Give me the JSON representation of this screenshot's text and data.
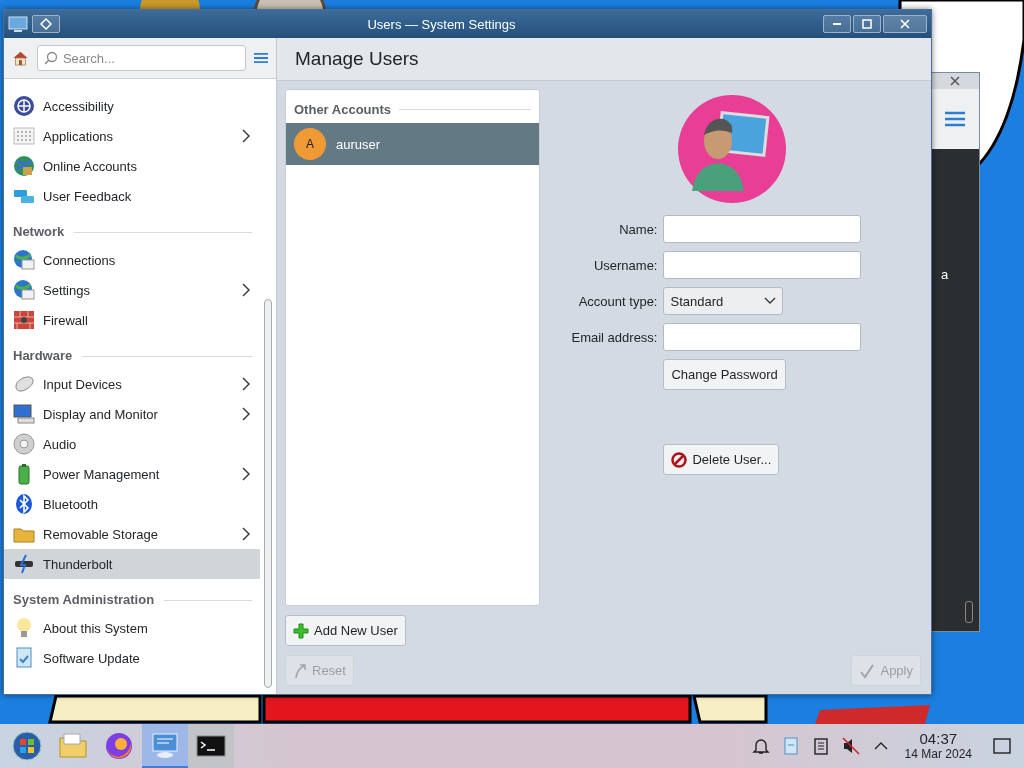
{
  "window": {
    "title": "Users — System Settings"
  },
  "sidebar": {
    "search": {
      "placeholder": "Search..."
    },
    "sections": [
      {
        "items": [
          {
            "label": "Accessibility",
            "kind": "accessibility",
            "has_children": false,
            "selected": false
          },
          {
            "label": "Applications",
            "kind": "applications",
            "has_children": true,
            "selected": false
          },
          {
            "label": "Online Accounts",
            "kind": "accounts",
            "has_children": false,
            "selected": false
          },
          {
            "label": "User Feedback",
            "kind": "feedback",
            "has_children": false,
            "selected": false
          }
        ]
      },
      {
        "title": "Network",
        "items": [
          {
            "label": "Connections",
            "kind": "globe",
            "has_children": false,
            "selected": false
          },
          {
            "label": "Settings",
            "kind": "globe",
            "has_children": true,
            "selected": false
          },
          {
            "label": "Firewall",
            "kind": "firewall",
            "has_children": false,
            "selected": false
          }
        ]
      },
      {
        "title": "Hardware",
        "items": [
          {
            "label": "Input Devices",
            "kind": "mouse",
            "has_children": true,
            "selected": false
          },
          {
            "label": "Display and Monitor",
            "kind": "monitor",
            "has_children": true,
            "selected": false
          },
          {
            "label": "Audio",
            "kind": "audio",
            "has_children": false,
            "selected": false
          },
          {
            "label": "Power Management",
            "kind": "power",
            "has_children": true,
            "selected": false
          },
          {
            "label": "Bluetooth",
            "kind": "bluetooth",
            "has_children": false,
            "selected": false
          },
          {
            "label": "Removable Storage",
            "kind": "folder",
            "has_children": true,
            "selected": false
          },
          {
            "label": "Thunderbolt",
            "kind": "thunderbolt",
            "has_children": false,
            "selected": true
          }
        ]
      },
      {
        "title": "System Administration",
        "items": [
          {
            "label": "About this System",
            "kind": "bulb",
            "has_children": false,
            "selected": false
          },
          {
            "label": "Software Update",
            "kind": "update",
            "has_children": false,
            "selected": false
          }
        ]
      }
    ]
  },
  "page": {
    "title": "Manage Users",
    "accounts": {
      "title": "Other Accounts",
      "users": [
        {
          "initial": "A",
          "name": "auruser",
          "selected": true
        }
      ]
    },
    "form": {
      "fields": [
        {
          "label": "Name:",
          "kind": "text"
        },
        {
          "label": "Username:",
          "kind": "text"
        },
        {
          "label": "Account type:",
          "kind": "select",
          "value": "Standard"
        },
        {
          "label": "Email address:",
          "kind": "text"
        }
      ],
      "change_password": "Change Password",
      "delete_user": "Delete User..."
    },
    "add_user": "Add New User",
    "reset": {
      "label": "Reset",
      "disabled": true
    },
    "apply": {
      "label": "Apply",
      "disabled": true
    }
  },
  "background_window": {
    "text": "a"
  },
  "taskbar": {
    "apps": [
      {
        "kind": "start",
        "selected": false,
        "open": false
      },
      {
        "kind": "files",
        "selected": false,
        "open": false
      },
      {
        "kind": "browser",
        "selected": false,
        "open": false
      },
      {
        "kind": "settings",
        "selected": true,
        "open": true
      },
      {
        "kind": "terminal",
        "selected": false,
        "open": true
      }
    ],
    "tray": [
      {
        "kind": "notifications"
      },
      {
        "kind": "clipboard-app"
      },
      {
        "kind": "clipboard"
      },
      {
        "kind": "muted"
      },
      {
        "kind": "expand"
      }
    ],
    "clock": {
      "time": "04:37",
      "date": "14 Mar 2024"
    }
  }
}
